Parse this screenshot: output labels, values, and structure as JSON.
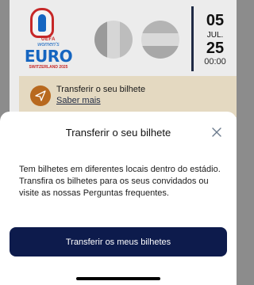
{
  "logo": {
    "uefa": "UEFA",
    "womens": "women's",
    "euro": "EURO",
    "host": "SWITZERLAND 2025"
  },
  "match": {
    "flag_a_colors": [
      "#9a9a9a",
      "#d6d6d6",
      "#bdbdbd"
    ],
    "flag_b_colors": [
      "#b4b4b4",
      "#d9d9d9",
      "#a8a8a8"
    ],
    "date": {
      "day": "05",
      "month": "JUL.",
      "year": "25",
      "time": "00:00"
    }
  },
  "banner": {
    "title": "Transferir o seu bilhete",
    "link": "Saber mais",
    "icon": "paper-plane-icon"
  },
  "sheet": {
    "title": "Transferir o seu bilhete",
    "close_icon": "close-icon",
    "body": "Tem bilhetes em diferentes locais dentro do estádio. Transfira os bilhetes para os seus convidados ou visite as nossas Perguntas frequentes.",
    "button_label": "Transferir os meus bilhetes"
  },
  "colors": {
    "primary": "#0d1b4c",
    "banner_bg": "#e4d9c1",
    "banner_icon": "#b8691f",
    "overlay": "#8c8c8c"
  }
}
